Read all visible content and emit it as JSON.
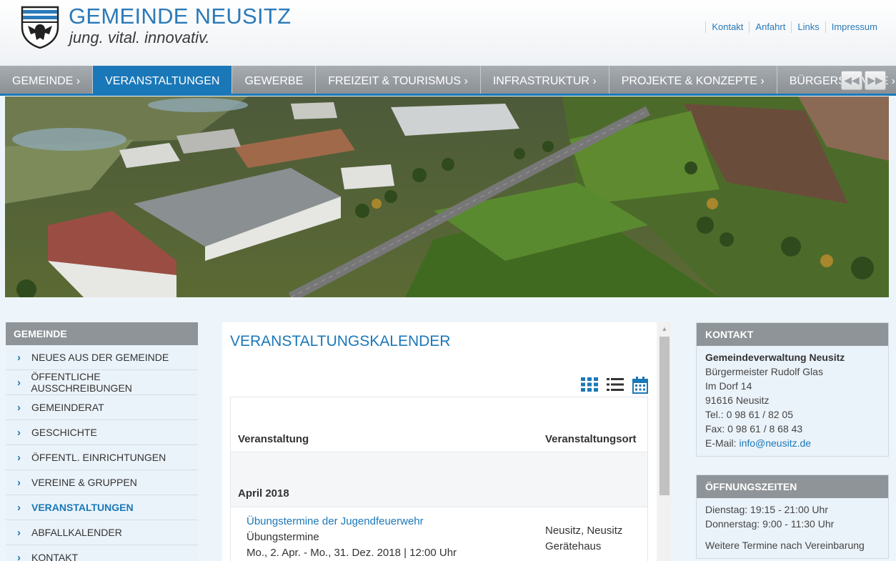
{
  "header": {
    "title": "GEMEINDE NEUSITZ",
    "slogan": "jung. vital. innovativ.",
    "links": [
      "Kontakt",
      "Anfahrt",
      "Links",
      "Impressum"
    ]
  },
  "nav": {
    "items": [
      "GEMEINDE ›",
      "VERANSTALTUNGEN",
      "GEWERBE",
      "FREIZEIT & TOURISMUS ›",
      "INFRASTRUKTUR ›",
      "PROJEKTE & KONZEPTE ›",
      "BÜRGERSERVICE ›"
    ],
    "active_index": 1,
    "prev_label": "◀◀",
    "next_label": "▶▶"
  },
  "sidebar": {
    "heading": "GEMEINDE",
    "items": [
      "NEUES AUS DER GEMEINDE",
      "ÖFFENTLICHE AUSSCHREIBUNGEN",
      "GEMEINDERAT",
      "GESCHICHTE",
      "ÖFFENTL. EINRICHTUNGEN",
      "VEREINE & GRUPPEN",
      "VERANSTALTUNGEN",
      "ABFALLKALENDER",
      "KONTAKT"
    ],
    "active_index": 6
  },
  "content": {
    "title": "VERANSTALTUNGSKALENDER",
    "view_icons": [
      "grid-view-icon",
      "list-view-icon",
      "calendar-view-icon"
    ],
    "table": {
      "col_event": "Veranstaltung",
      "col_place": "Veranstaltungsort",
      "month": "April 2018",
      "event": {
        "title": "Übungstermine der Jugendfeuerwehr",
        "subtitle": "Übungstermine",
        "date": "Mo., 2. Apr. - Mo., 31. Dez. 2018 | 12:00 Uhr",
        "place_line1": "Neusitz, Neusitz",
        "place_line2": "Gerätehaus"
      }
    }
  },
  "kontakt": {
    "heading": "KONTAKT",
    "org": "Gemeindeverwaltung Neusitz",
    "mayor": "Bürgermeister Rudolf Glas",
    "street": "Im Dorf 14",
    "city": "91616 Neusitz",
    "tel": "Tel.: 0 98 61 / 82 05",
    "fax": "Fax: 0 98 61 / 8 68 43",
    "email_label": "E-Mail:",
    "email": "info@neusitz.de"
  },
  "oeffnungszeiten": {
    "heading": "ÖFFNUNGSZEITEN",
    "line1": "Dienstag: 19:15 - 21:00 Uhr",
    "line2": "Donnerstag: 9:00 - 11:30 Uhr",
    "line3": "Weitere Termine nach Vereinbarung"
  },
  "colors": {
    "brand_blue": "#1b78b8",
    "nav_grey": "#8f9498",
    "panel_bg": "#ebf3fa"
  }
}
